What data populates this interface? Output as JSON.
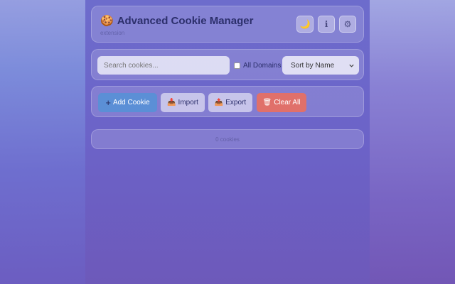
{
  "header": {
    "icon": "cookie-icon",
    "title": "Advanced Cookie Manager",
    "subtitle": "extension",
    "buttons": [
      {
        "name": "theme-toggle-button",
        "icon": "moon-icon",
        "glyph": "🌙"
      },
      {
        "name": "info-button",
        "icon": "info-icon",
        "glyph": "ℹ"
      },
      {
        "name": "settings-button",
        "icon": "gear-icon",
        "glyph": "⚙"
      }
    ]
  },
  "search": {
    "placeholder": "Search cookies...",
    "all_domains_label": "All Domains",
    "all_domains_checked": false,
    "sort_selected": "Sort by Name"
  },
  "actions": {
    "add_label": "Add Cookie",
    "add_glyph": "+",
    "import_label": "Import",
    "import_glyph": "📥",
    "export_label": "Export",
    "export_glyph": "📤",
    "clear_label": "Clear All",
    "clear_glyph": "🗑"
  },
  "status": {
    "count_text": "0 cookies"
  },
  "colors": {
    "accent_blue": "#5b8fd6",
    "danger_red": "#e0706a",
    "title_text": "#2c2f6b"
  }
}
